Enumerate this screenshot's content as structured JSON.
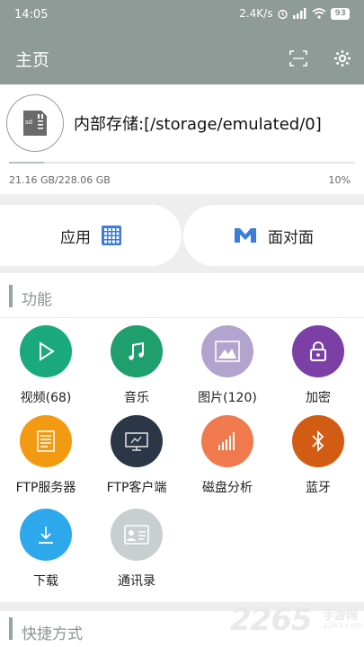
{
  "status_bar": {
    "time": "14:05",
    "net_speed": "2.4K/s",
    "battery": "93"
  },
  "app_bar": {
    "title": "主页",
    "scan_icon": "scan-icon",
    "settings_icon": "gear-icon"
  },
  "storage": {
    "path": "内部存储:[/storage/emulated/0]",
    "used": "21.16 GB/228.06 GB",
    "percent_text": "10%",
    "percent_value": 0.1
  },
  "tabs": {
    "apps": "应用",
    "face_to_face": "面对面"
  },
  "features": {
    "title": "功能",
    "items": [
      {
        "label": "视频(68)",
        "icon": "play-icon",
        "color": "#1aa97b"
      },
      {
        "label": "音乐",
        "icon": "music-note-icon",
        "color": "#1f9e6e"
      },
      {
        "label": "图片(120)",
        "icon": "image-icon",
        "color": "#b3a4cf"
      },
      {
        "label": "加密",
        "icon": "lock-icon",
        "color": "#7b3fa6"
      },
      {
        "label": "FTP服务器",
        "icon": "ftp-server-icon",
        "color": "#f29a12"
      },
      {
        "label": "FTP客户端",
        "icon": "ftp-client-icon",
        "color": "#2b3646"
      },
      {
        "label": "磁盘分析",
        "icon": "disk-analysis-icon",
        "color": "#f07a4e"
      },
      {
        "label": "蓝牙",
        "icon": "bluetooth-icon",
        "color": "#d35c14"
      },
      {
        "label": "下载",
        "icon": "download-icon",
        "color": "#2ea8ec"
      },
      {
        "label": "通讯录",
        "icon": "contacts-icon",
        "color": "#c8cfd0"
      }
    ]
  },
  "shortcuts": {
    "title": "快捷方式"
  },
  "watermark": {
    "number": "2265",
    "cn": "手游网",
    "url": "2265.com"
  }
}
